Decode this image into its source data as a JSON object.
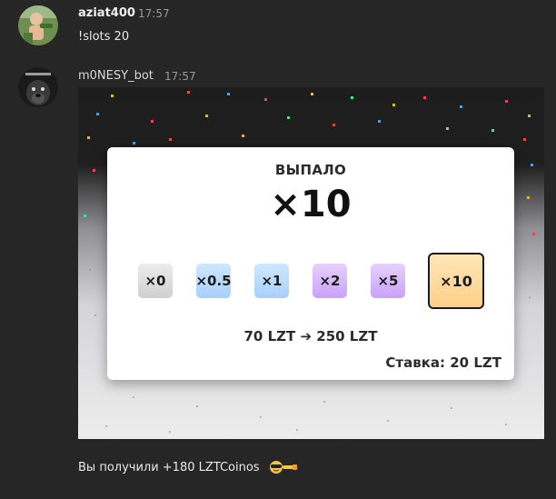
{
  "messages": [
    {
      "username": "aziat400",
      "time": "17:57",
      "text": "!slots 20"
    },
    {
      "username": "m0NESY_bot",
      "time": "17:57",
      "result_text": "Вы получили +180 LZTCoinos"
    }
  ],
  "result_card": {
    "title": "ВЫПАЛО",
    "value": "×10",
    "multipliers": [
      {
        "label": "×0",
        "color": "#d9d9d9",
        "selected": false
      },
      {
        "label": "×0.5",
        "color": "#b8dcff",
        "selected": false
      },
      {
        "label": "×1",
        "color": "#b8dcff",
        "selected": false
      },
      {
        "label": "×2",
        "color": "#d7b5ff",
        "selected": false
      },
      {
        "label": "×5",
        "color": "#d7b5ff",
        "selected": false
      },
      {
        "label": "×10",
        "color": "#ffd99a",
        "selected": true
      }
    ],
    "conversion": "70 LZT ➔ 250 LZT",
    "bet": "Ставка: 20 LZT"
  },
  "icons": {
    "avatar_user": "child-photo-avatar",
    "avatar_bot": "dog-photo-avatar",
    "emoji": "sunglasses-face-emoji"
  },
  "colors": {
    "background": "#262626",
    "card": "#ffffff"
  }
}
